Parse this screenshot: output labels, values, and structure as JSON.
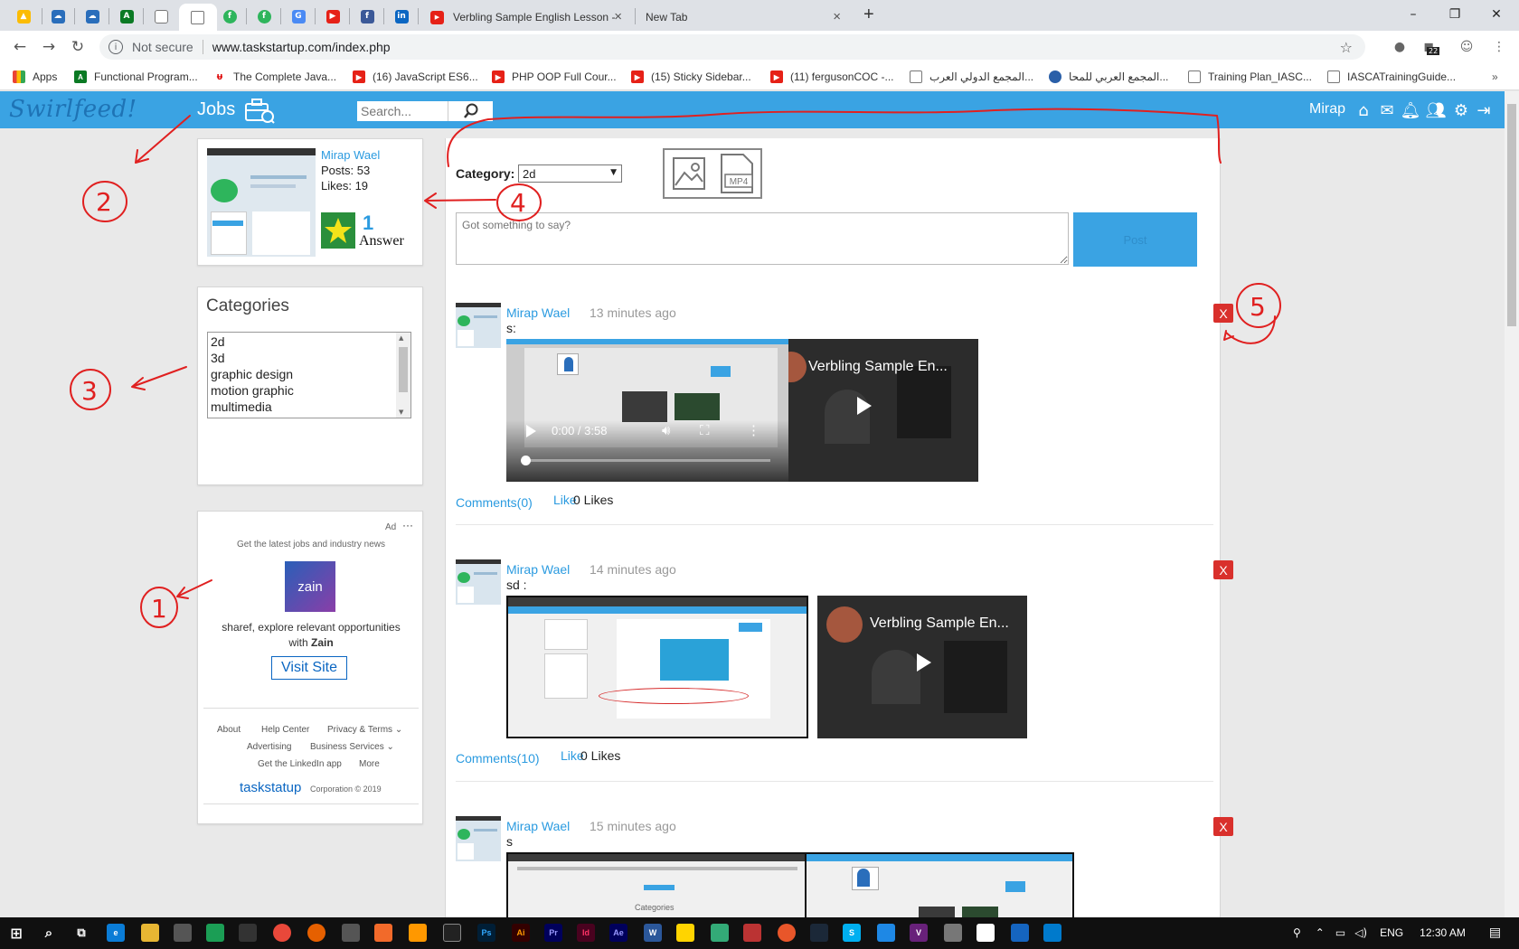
{
  "browser": {
    "tabs": [
      {
        "label": "Verbling Sample English Lesson -"
      },
      {
        "label": "New Tab"
      }
    ],
    "new_tab_symbol": "+",
    "window_controls": {
      "minimize": "–",
      "maximize": "❐",
      "close": "✕"
    },
    "address": {
      "security": "Not secure",
      "url": "www.taskstartup.com/index.php"
    },
    "profile_badge": "22",
    "bookmarks": [
      {
        "label": "Apps",
        "icon": "apps-grid-icon"
      },
      {
        "label": "Functional Program...",
        "icon": "bookmark-icon"
      },
      {
        "label": "The Complete Java...",
        "icon": "bookmark-icon"
      },
      {
        "label": "(16) JavaScript ES6...",
        "icon": "youtube-icon"
      },
      {
        "label": "PHP OOP Full Cour...",
        "icon": "youtube-icon"
      },
      {
        "label": "(15) Sticky Sidebar...",
        "icon": "youtube-icon"
      },
      {
        "label": "(11) fergusonCOC -...",
        "icon": "youtube-icon"
      },
      {
        "label": "المجمع الدولي العرب...",
        "icon": "document-icon"
      },
      {
        "label": "المجمع العربي للمحا...",
        "icon": "bookmark-icon"
      },
      {
        "label": "Training Plan_IASC...",
        "icon": "document-icon"
      },
      {
        "label": "IASCATrainingGuide...",
        "icon": "document-icon"
      }
    ]
  },
  "site": {
    "logo": "Swirlfeed!",
    "nav_jobs": "Jobs",
    "search_placeholder": "Search...",
    "user": "Mirap",
    "colors": {
      "header": "#3aa3e3",
      "link": "#2b9be0",
      "delete": "#d9302c"
    }
  },
  "profile": {
    "name": "Mirap Wael",
    "posts": "Posts: 53",
    "likes": "Likes: 19",
    "answer_count": "1",
    "answer_label": "Answer"
  },
  "categories": {
    "title": "Categories",
    "items": [
      "2d",
      "3d",
      "graphic design",
      "motion graphic",
      "multimedia"
    ]
  },
  "ad": {
    "label": "Ad",
    "more": "···",
    "headline": "Get the latest jobs and industry news",
    "brand": "zain",
    "body": "sharef, explore relevant opportunities",
    "body2_prefix": "with ",
    "body2_brand": "Zain",
    "cta": "Visit Site",
    "footer_links": [
      "About",
      "Help Center",
      "Privacy & Terms",
      "Advertising",
      "Business Services",
      "Get the LinkedIn app",
      "More"
    ],
    "footer_brand": "taskstatup",
    "footer_copy": "Corporation © 2019"
  },
  "composer": {
    "category_label": "Category:",
    "category_value": "2d",
    "media_icons": [
      "image-icon",
      "mp4-file-icon"
    ],
    "mp4_text": "MP4",
    "placeholder": "Got something to say?",
    "post_label": "Post"
  },
  "posts": [
    {
      "author": "Mirap Wael",
      "time": "13 minutes ago",
      "body": "s:",
      "delete": "X",
      "video_time": "0:00 / 3:58",
      "embed_title": "Verbling Sample En...",
      "comments": "Comments(0)",
      "like": "Like",
      "likes": "0 Likes"
    },
    {
      "author": "Mirap Wael",
      "time": "14 minutes ago",
      "body": "sd :",
      "delete": "X",
      "embed_title": "Verbling Sample En...",
      "comments": "Comments(10)",
      "like": "Like",
      "likes": "0 Likes"
    },
    {
      "author": "Mirap Wael",
      "time": "15 minutes ago",
      "body": "s",
      "delete": "X",
      "media_text": "Categories"
    }
  ],
  "annotations": [
    "2",
    "3",
    "1",
    "4",
    "5"
  ],
  "taskbar": {
    "language": "ENG",
    "clock": "12:30 AM"
  }
}
